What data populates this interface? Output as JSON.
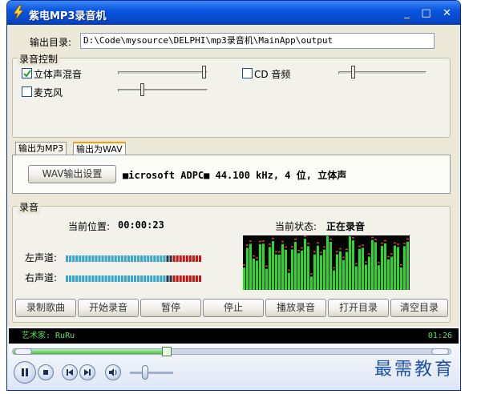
{
  "window": {
    "title": "紫电MP3录音机"
  },
  "titlebar_buttons": {
    "minimize": "_",
    "maximize": "□",
    "close": "✕"
  },
  "output": {
    "label": "输出目录:",
    "path": "D:\\Code\\mysource\\DELPHI\\mp3录音机\\MainApp\\output"
  },
  "record_control": {
    "legend": "录音控制",
    "stereo_mix": {
      "label": "立体声混音",
      "checked": true,
      "level": 1.0
    },
    "mic": {
      "label": "麦克风",
      "checked": false,
      "level": 0.26
    },
    "cd_audio": {
      "label": "CD 音频",
      "checked": false,
      "level": 0.18
    }
  },
  "tabs": [
    {
      "label": "输出为MP3",
      "active": false
    },
    {
      "label": "输出为WAV",
      "active": true
    }
  ],
  "wav": {
    "settings_button": "WAV输出设置",
    "format_text": "■icrosoft ADPC■ 44.100 kHz, 4 位, 立体声"
  },
  "recording": {
    "legend": "录音",
    "position_label": "当前位置:",
    "position_value": "00:00:23",
    "status_label": "当前状态:",
    "status_value": "正在录音",
    "left_channel_label": "左声道:",
    "right_channel_label": "右声道:",
    "left_level": 0.72,
    "right_level": 0.72
  },
  "buttons": [
    "录制歌曲",
    "开始录音",
    "暂停",
    "停止",
    "播放录音",
    "打开目录",
    "清空目录"
  ],
  "player": {
    "artist_text": "艺术家: RuRu",
    "time": "01:26",
    "progress": 0.35,
    "volume": 0.35
  },
  "watermark": "最需教育",
  "colors": {
    "title_blue": "#0a55e0",
    "meter_on": "#3aa5c4",
    "meter_peak": "#c01818",
    "spectrum_green": "#2bd92b",
    "tab_accent": "#ff9c00"
  }
}
